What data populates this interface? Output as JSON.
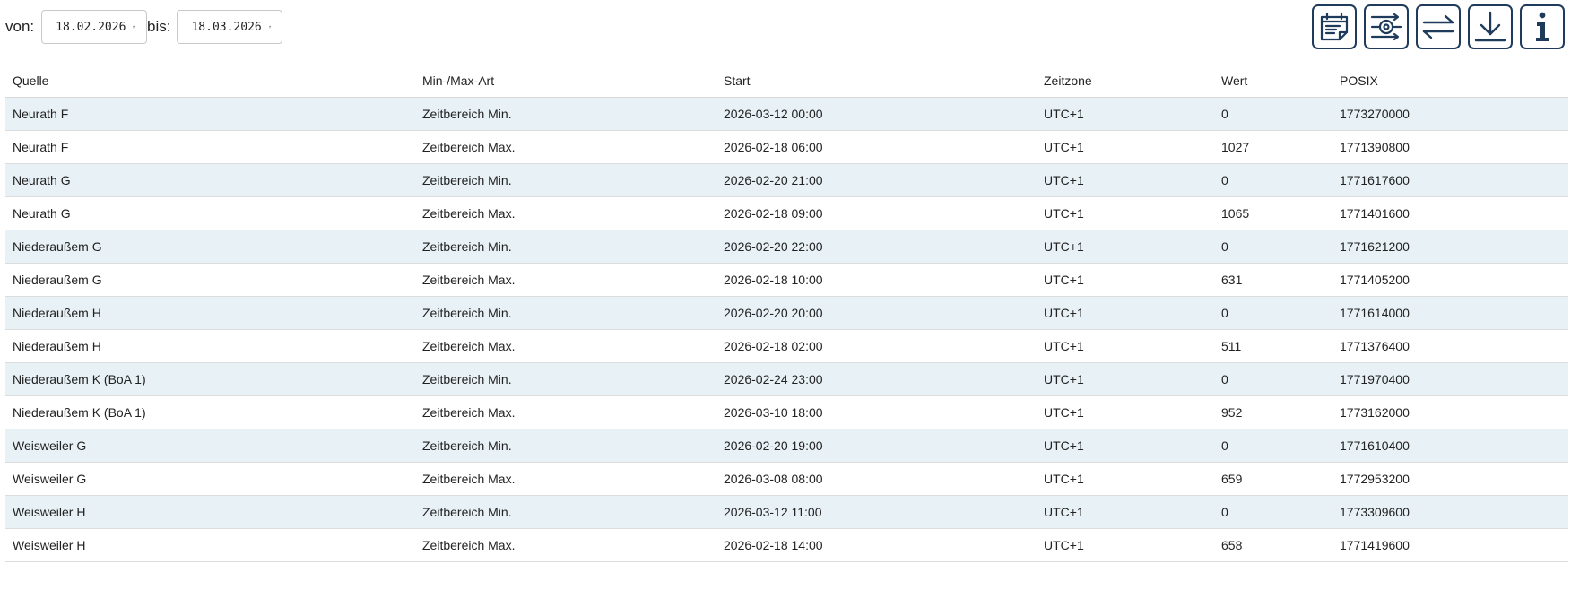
{
  "filter": {
    "from_label": "von:",
    "from_value": "18.02.2026",
    "to_label": "bis:",
    "to_value": "18.03.2026"
  },
  "toolbar_icons": [
    "calendar-note-icon",
    "sliders-settings-icon",
    "swap-arrows-icon",
    "download-icon",
    "info-icon"
  ],
  "colors": {
    "icon_border": "#1f3b5c",
    "row_stripe": "#e8f1f6"
  },
  "table": {
    "headers": [
      "Quelle",
      "Min-/Max-Art",
      "Start",
      "Zeitzone",
      "Wert",
      "POSIX"
    ],
    "rows": [
      [
        "Neurath F",
        "Zeitbereich Min.",
        "2026-03-12 00:00",
        "UTC+1",
        "0",
        "1773270000"
      ],
      [
        "Neurath F",
        "Zeitbereich Max.",
        "2026-02-18 06:00",
        "UTC+1",
        "1027",
        "1771390800"
      ],
      [
        "Neurath G",
        "Zeitbereich Min.",
        "2026-02-20 21:00",
        "UTC+1",
        "0",
        "1771617600"
      ],
      [
        "Neurath G",
        "Zeitbereich Max.",
        "2026-02-18 09:00",
        "UTC+1",
        "1065",
        "1771401600"
      ],
      [
        "Niederaußem G",
        "Zeitbereich Min.",
        "2026-02-20 22:00",
        "UTC+1",
        "0",
        "1771621200"
      ],
      [
        "Niederaußem G",
        "Zeitbereich Max.",
        "2026-02-18 10:00",
        "UTC+1",
        "631",
        "1771405200"
      ],
      [
        "Niederaußem H",
        "Zeitbereich Min.",
        "2026-02-20 20:00",
        "UTC+1",
        "0",
        "1771614000"
      ],
      [
        "Niederaußem H",
        "Zeitbereich Max.",
        "2026-02-18 02:00",
        "UTC+1",
        "511",
        "1771376400"
      ],
      [
        "Niederaußem K (BoA 1)",
        "Zeitbereich Min.",
        "2026-02-24 23:00",
        "UTC+1",
        "0",
        "1771970400"
      ],
      [
        "Niederaußem K (BoA 1)",
        "Zeitbereich Max.",
        "2026-03-10 18:00",
        "UTC+1",
        "952",
        "1773162000"
      ],
      [
        "Weisweiler G",
        "Zeitbereich Min.",
        "2026-02-20 19:00",
        "UTC+1",
        "0",
        "1771610400"
      ],
      [
        "Weisweiler G",
        "Zeitbereich Max.",
        "2026-03-08 08:00",
        "UTC+1",
        "659",
        "1772953200"
      ],
      [
        "Weisweiler H",
        "Zeitbereich Min.",
        "2026-03-12 11:00",
        "UTC+1",
        "0",
        "1773309600"
      ],
      [
        "Weisweiler H",
        "Zeitbereich Max.",
        "2026-02-18 14:00",
        "UTC+1",
        "658",
        "1771419600"
      ]
    ]
  }
}
